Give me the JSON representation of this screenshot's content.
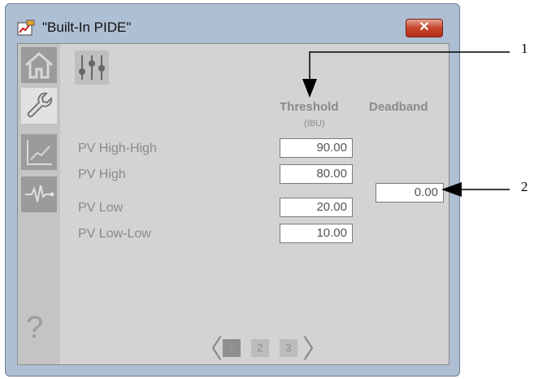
{
  "window": {
    "title": "\"Built-In PIDE\"",
    "close_label": "✕"
  },
  "nav": {
    "items": [
      {
        "name": "home-icon"
      },
      {
        "name": "wrench-icon"
      },
      {
        "name": "trend-icon"
      },
      {
        "name": "waveform-icon"
      }
    ],
    "help_label": "?"
  },
  "table": {
    "threshold_header": "Threshold",
    "threshold_unit": "(IBU)",
    "deadband_header": "Deadband",
    "rows": [
      {
        "label": "PV High-High",
        "value": "90.00"
      },
      {
        "label": "PV High",
        "value": "80.00"
      },
      {
        "label": "PV Low",
        "value": "20.00"
      },
      {
        "label": "PV Low-Low",
        "value": "10.00"
      }
    ],
    "deadband_value": "0.00"
  },
  "pager": {
    "prev": "〈",
    "next": "〉",
    "pages": [
      "1",
      "2",
      "3"
    ],
    "current": "1"
  },
  "callouts": [
    "1",
    "2"
  ]
}
